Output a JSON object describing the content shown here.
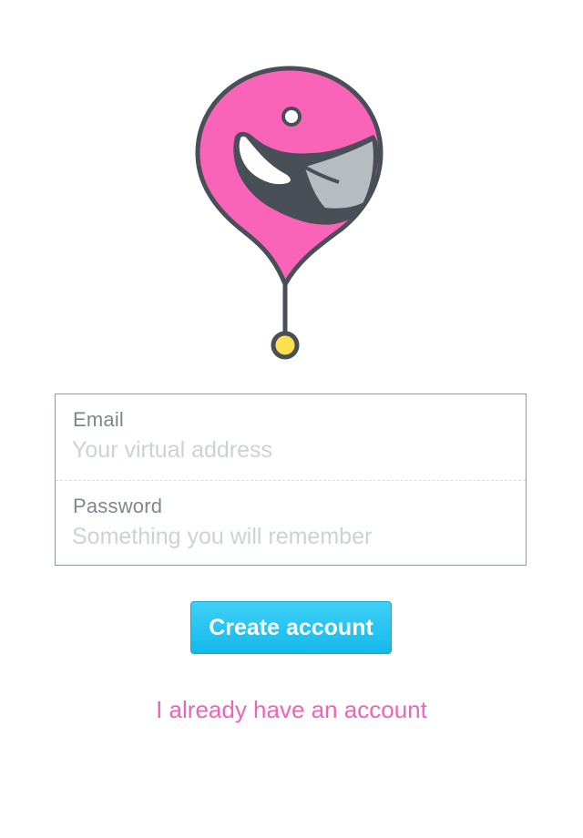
{
  "logo": {
    "icon": "flamingo-pin-icon",
    "colors": {
      "pink": "#f964b9",
      "outline": "#484f57",
      "beak_gray": "#b7bcc3",
      "pin_yellow": "#fbe14e"
    }
  },
  "form": {
    "email": {
      "label": "Email",
      "placeholder": "Your virtual address",
      "value": ""
    },
    "password": {
      "label": "Password",
      "placeholder": "Something you will remember",
      "value": ""
    }
  },
  "actions": {
    "create_label": "Create account",
    "login_link": "I already have an account"
  },
  "colors": {
    "accent": "#13b9ec",
    "link": "#f063b8",
    "border": "#8e99a4"
  }
}
